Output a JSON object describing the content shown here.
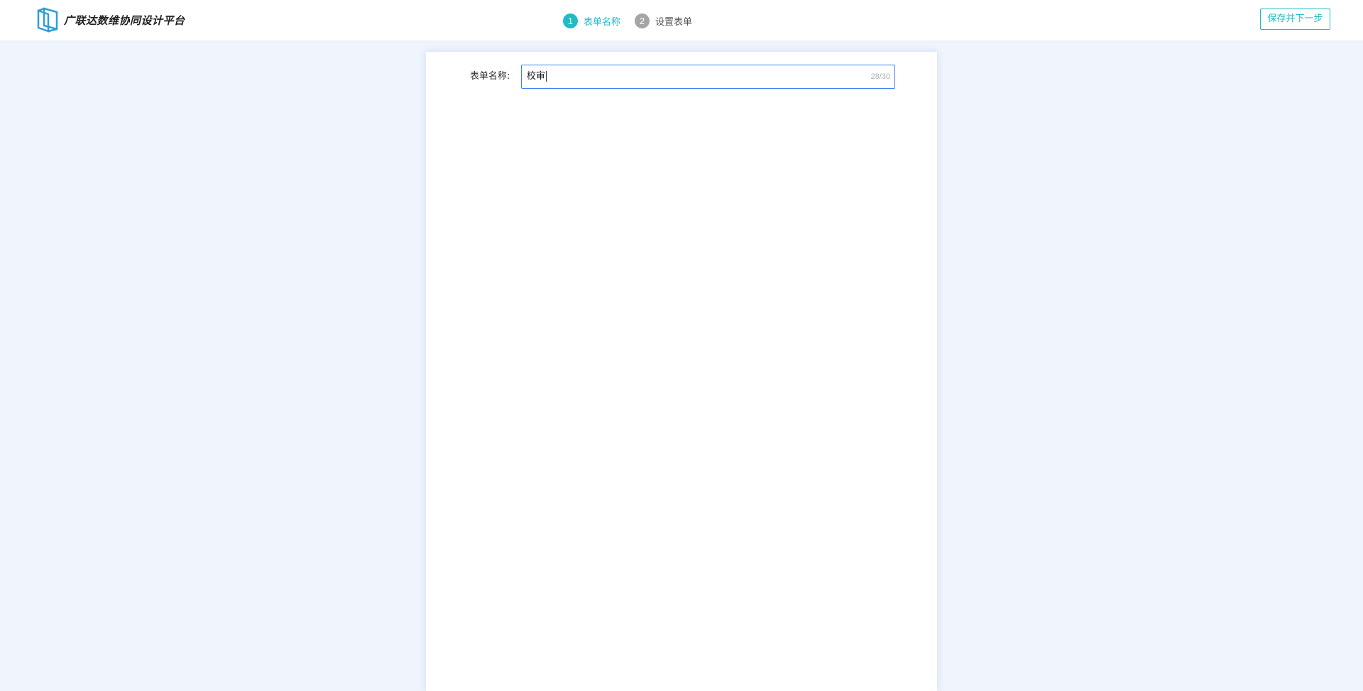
{
  "header": {
    "brand_name": "广联达数维协同设计平台",
    "steps": [
      {
        "number": "1",
        "label": "表单名称",
        "state": "active"
      },
      {
        "number": "2",
        "label": "设置表单",
        "state": "inactive"
      }
    ],
    "save_next_label": "保存并下一步"
  },
  "form": {
    "name_label": "表单名称:",
    "name_value": "校审",
    "name_counter": "28/30"
  },
  "colors": {
    "accent": "#1fbcc4",
    "inactive_step": "#a5a5a5",
    "input_focus_border": "#3a7ff0",
    "page_background": "#eff4fd"
  },
  "icons": {
    "logo": "brand-logo-icon"
  }
}
